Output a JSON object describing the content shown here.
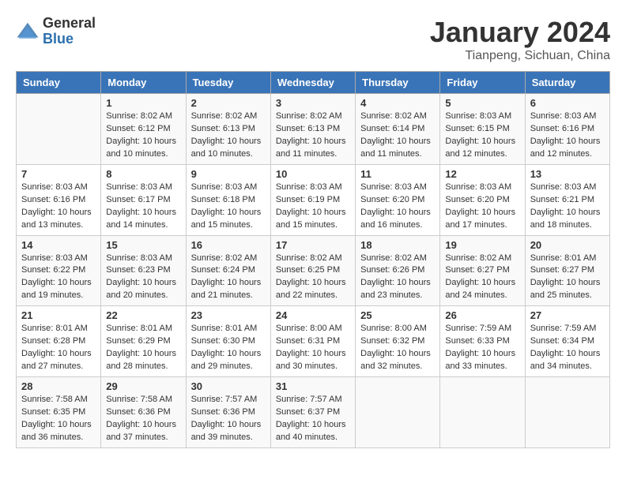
{
  "logo": {
    "general": "General",
    "blue": "Blue"
  },
  "title": "January 2024",
  "location": "Tianpeng, Sichuan, China",
  "days_of_week": [
    "Sunday",
    "Monday",
    "Tuesday",
    "Wednesday",
    "Thursday",
    "Friday",
    "Saturday"
  ],
  "weeks": [
    [
      {
        "num": "",
        "info": ""
      },
      {
        "num": "1",
        "info": "Sunrise: 8:02 AM\nSunset: 6:12 PM\nDaylight: 10 hours\nand 10 minutes."
      },
      {
        "num": "2",
        "info": "Sunrise: 8:02 AM\nSunset: 6:13 PM\nDaylight: 10 hours\nand 10 minutes."
      },
      {
        "num": "3",
        "info": "Sunrise: 8:02 AM\nSunset: 6:13 PM\nDaylight: 10 hours\nand 11 minutes."
      },
      {
        "num": "4",
        "info": "Sunrise: 8:02 AM\nSunset: 6:14 PM\nDaylight: 10 hours\nand 11 minutes."
      },
      {
        "num": "5",
        "info": "Sunrise: 8:03 AM\nSunset: 6:15 PM\nDaylight: 10 hours\nand 12 minutes."
      },
      {
        "num": "6",
        "info": "Sunrise: 8:03 AM\nSunset: 6:16 PM\nDaylight: 10 hours\nand 12 minutes."
      }
    ],
    [
      {
        "num": "7",
        "info": "Sunrise: 8:03 AM\nSunset: 6:16 PM\nDaylight: 10 hours\nand 13 minutes."
      },
      {
        "num": "8",
        "info": "Sunrise: 8:03 AM\nSunset: 6:17 PM\nDaylight: 10 hours\nand 14 minutes."
      },
      {
        "num": "9",
        "info": "Sunrise: 8:03 AM\nSunset: 6:18 PM\nDaylight: 10 hours\nand 15 minutes."
      },
      {
        "num": "10",
        "info": "Sunrise: 8:03 AM\nSunset: 6:19 PM\nDaylight: 10 hours\nand 15 minutes."
      },
      {
        "num": "11",
        "info": "Sunrise: 8:03 AM\nSunset: 6:20 PM\nDaylight: 10 hours\nand 16 minutes."
      },
      {
        "num": "12",
        "info": "Sunrise: 8:03 AM\nSunset: 6:20 PM\nDaylight: 10 hours\nand 17 minutes."
      },
      {
        "num": "13",
        "info": "Sunrise: 8:03 AM\nSunset: 6:21 PM\nDaylight: 10 hours\nand 18 minutes."
      }
    ],
    [
      {
        "num": "14",
        "info": "Sunrise: 8:03 AM\nSunset: 6:22 PM\nDaylight: 10 hours\nand 19 minutes."
      },
      {
        "num": "15",
        "info": "Sunrise: 8:03 AM\nSunset: 6:23 PM\nDaylight: 10 hours\nand 20 minutes."
      },
      {
        "num": "16",
        "info": "Sunrise: 8:02 AM\nSunset: 6:24 PM\nDaylight: 10 hours\nand 21 minutes."
      },
      {
        "num": "17",
        "info": "Sunrise: 8:02 AM\nSunset: 6:25 PM\nDaylight: 10 hours\nand 22 minutes."
      },
      {
        "num": "18",
        "info": "Sunrise: 8:02 AM\nSunset: 6:26 PM\nDaylight: 10 hours\nand 23 minutes."
      },
      {
        "num": "19",
        "info": "Sunrise: 8:02 AM\nSunset: 6:27 PM\nDaylight: 10 hours\nand 24 minutes."
      },
      {
        "num": "20",
        "info": "Sunrise: 8:01 AM\nSunset: 6:27 PM\nDaylight: 10 hours\nand 25 minutes."
      }
    ],
    [
      {
        "num": "21",
        "info": "Sunrise: 8:01 AM\nSunset: 6:28 PM\nDaylight: 10 hours\nand 27 minutes."
      },
      {
        "num": "22",
        "info": "Sunrise: 8:01 AM\nSunset: 6:29 PM\nDaylight: 10 hours\nand 28 minutes."
      },
      {
        "num": "23",
        "info": "Sunrise: 8:01 AM\nSunset: 6:30 PM\nDaylight: 10 hours\nand 29 minutes."
      },
      {
        "num": "24",
        "info": "Sunrise: 8:00 AM\nSunset: 6:31 PM\nDaylight: 10 hours\nand 30 minutes."
      },
      {
        "num": "25",
        "info": "Sunrise: 8:00 AM\nSunset: 6:32 PM\nDaylight: 10 hours\nand 32 minutes."
      },
      {
        "num": "26",
        "info": "Sunrise: 7:59 AM\nSunset: 6:33 PM\nDaylight: 10 hours\nand 33 minutes."
      },
      {
        "num": "27",
        "info": "Sunrise: 7:59 AM\nSunset: 6:34 PM\nDaylight: 10 hours\nand 34 minutes."
      }
    ],
    [
      {
        "num": "28",
        "info": "Sunrise: 7:58 AM\nSunset: 6:35 PM\nDaylight: 10 hours\nand 36 minutes."
      },
      {
        "num": "29",
        "info": "Sunrise: 7:58 AM\nSunset: 6:36 PM\nDaylight: 10 hours\nand 37 minutes."
      },
      {
        "num": "30",
        "info": "Sunrise: 7:57 AM\nSunset: 6:36 PM\nDaylight: 10 hours\nand 39 minutes."
      },
      {
        "num": "31",
        "info": "Sunrise: 7:57 AM\nSunset: 6:37 PM\nDaylight: 10 hours\nand 40 minutes."
      },
      {
        "num": "",
        "info": ""
      },
      {
        "num": "",
        "info": ""
      },
      {
        "num": "",
        "info": ""
      }
    ]
  ]
}
